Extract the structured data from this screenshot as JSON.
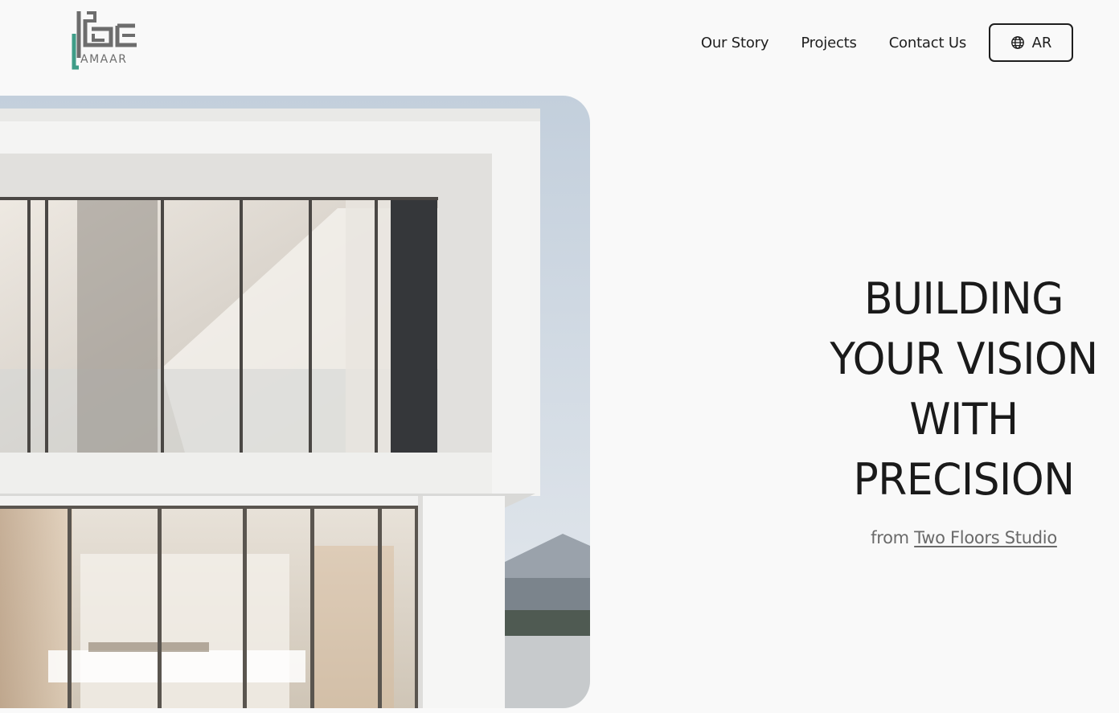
{
  "brand": {
    "logo_text": "AMAAR",
    "colors": {
      "accent": "#3f9d88",
      "logo_gray": "#6d6d6d"
    }
  },
  "nav": {
    "links": [
      {
        "label": "Our Story"
      },
      {
        "label": "Projects"
      },
      {
        "label": "Contact Us"
      }
    ],
    "language_button": {
      "label": "AR",
      "icon": "globe-icon"
    }
  },
  "hero": {
    "headline_lines": [
      "BUILDING",
      "YOUR VISION",
      "WITH",
      "PRECISION"
    ],
    "sub_prefix": "from",
    "sub_link": "Two Floors Studio",
    "image": {
      "description_icon": "modern-house-photo"
    }
  }
}
